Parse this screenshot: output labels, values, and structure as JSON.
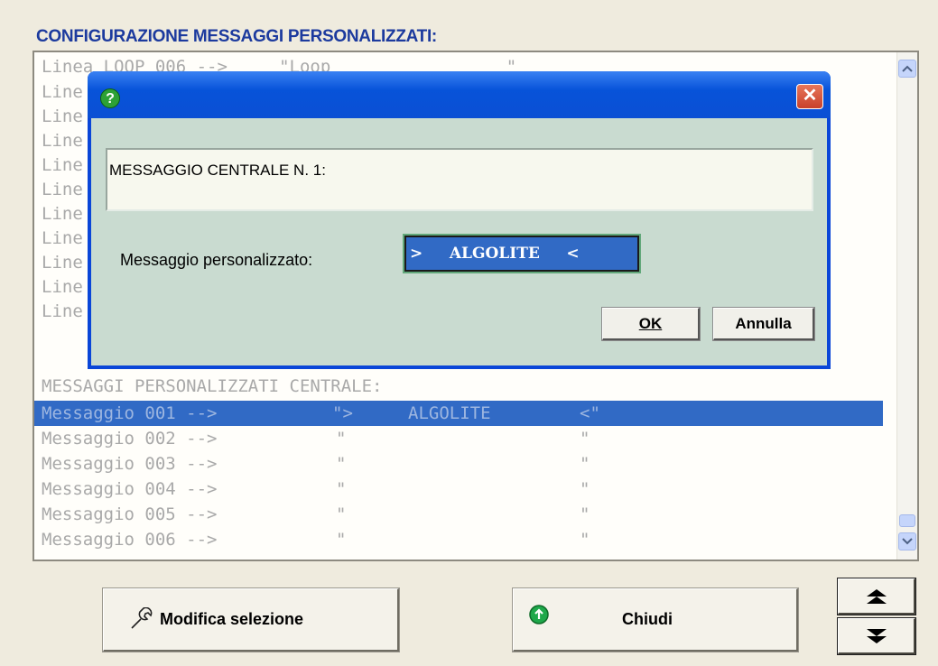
{
  "header": {
    "title": "CONFIGURAZIONE MESSAGGI PERSONALIZZATI:"
  },
  "list": {
    "first_line": "Linea LOOP 006 -->     \"Loop                 \"",
    "partial_lines": [
      "Line",
      "Line",
      "Line",
      "Line",
      "Line",
      "Line",
      "Line",
      "Line",
      "Line",
      "Line"
    ],
    "section_header": "MESSAGGI PERSONALIZZATI CENTRALE:",
    "rows": [
      {
        "label": "Messaggio 001 -->",
        "q1": "\">",
        "text": "ALGOLITE",
        "q2": "<\""
      },
      {
        "label": "Messaggio 002 -->",
        "q1": "\"",
        "text": "",
        "q2": "\""
      },
      {
        "label": "Messaggio 003 -->",
        "q1": "\"",
        "text": "",
        "q2": "\""
      },
      {
        "label": "Messaggio 004 -->",
        "q1": "\"",
        "text": "",
        "q2": "\""
      },
      {
        "label": "Messaggio 005 -->",
        "q1": "\"",
        "text": "",
        "q2": "\""
      },
      {
        "label": "Messaggio 006 -->",
        "q1": "\"",
        "text": "",
        "q2": "\""
      }
    ],
    "selected_row": 0
  },
  "dialog": {
    "help_glyph": "?",
    "close_glyph": "✕",
    "message_text": "MESSAGGIO CENTRALE N.  1:",
    "field_label": "Messaggio personalizzato:",
    "field_value": ">     ALGOLITE     <",
    "ok_label": "OK",
    "cancel_label": "Annulla"
  },
  "footer": {
    "modify_label": "Modifica selezione",
    "close_label": "Chiudi",
    "up_glyph": "⏶",
    "down_glyph": "⏷"
  },
  "icons": {
    "modify_icon": "wrench-icon",
    "close_icon": "green-up-arrow-icon",
    "help_icon": "question-icon"
  },
  "colors": {
    "title": "#1c3a9e",
    "selection": "#316ac5",
    "dialog_body": "#c9dbd0"
  }
}
